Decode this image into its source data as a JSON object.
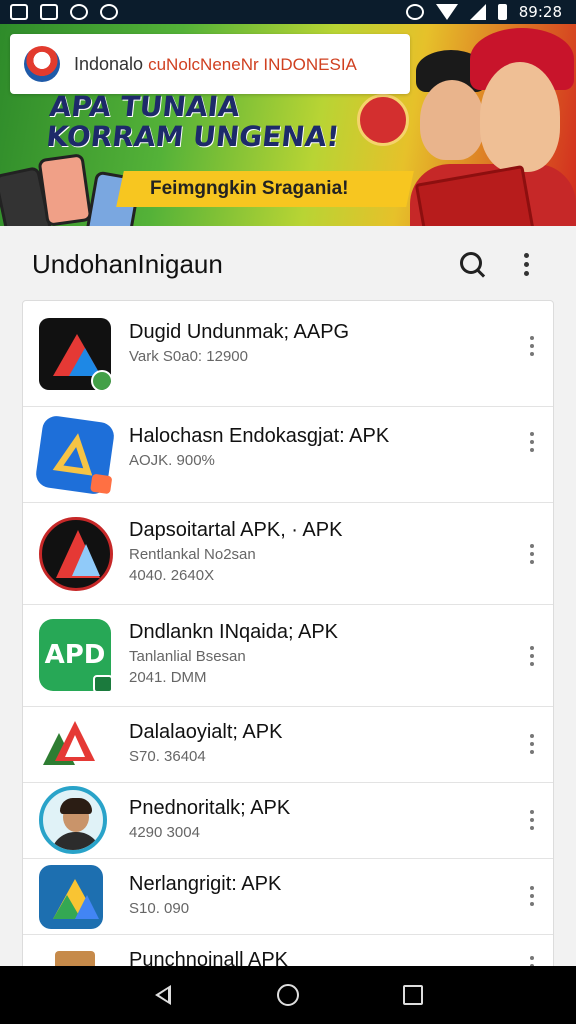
{
  "status_bar": {
    "time": "89:28",
    "left_icons": [
      "home-icon",
      "image-icon",
      "circle-icon",
      "alien-icon"
    ],
    "right_icons": [
      "alarm-icon",
      "wifi-icon",
      "signal-icon",
      "battery-icon"
    ]
  },
  "banner": {
    "brand": "Indonalo",
    "brand_sub": "cuNolcNeneNr INDONESIA",
    "headline_1": "APA TUNAIA",
    "headline_2": "KORRAM UNGENA!",
    "tagline": "Feimgngkin Sragania!"
  },
  "header": {
    "title": "UndohanInigaun"
  },
  "apps": [
    {
      "title": "Dugid Undunmak; AAPG",
      "lines": [
        "Vark S0a0: 12900"
      ]
    },
    {
      "title": "Halochasn Endokasgjat: APK",
      "lines": [
        "AOJK. 900%"
      ]
    },
    {
      "title": "Dapsoitartal APK, · APK",
      "lines": [
        "Rentlankal No2san",
        "4040. 2640X"
      ]
    },
    {
      "title": "Dndlankn INqaida; APK",
      "lines": [
        "Tanlanlial Bsesan",
        "2041. DMM"
      ]
    },
    {
      "title": "Dalalaoyialt; APK",
      "lines": [
        "S70. 36404"
      ]
    },
    {
      "title": "Pnednoritalk; APK",
      "lines": [
        "4290 3004"
      ]
    },
    {
      "title": "Nerlangrigit: APK",
      "lines": [
        "S10. 090"
      ]
    },
    {
      "title": "Punchnoinall APK",
      "lines": []
    }
  ],
  "colors": {
    "status_bar": "#0b1c2c",
    "banner_green": "#54b238",
    "banner_red": "#d22a1e",
    "nav_bar": "#000000"
  }
}
